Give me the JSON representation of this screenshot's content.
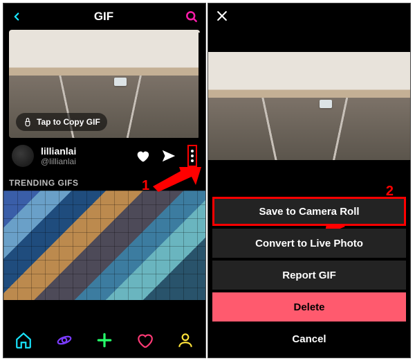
{
  "left": {
    "header_title": "GIF",
    "tap_label": "Tap to Copy GIF",
    "author_name": "lillianlai",
    "author_handle": "@lillianlai",
    "trending_label": "TRENDING GIFS",
    "annotation": "1"
  },
  "right": {
    "annotation": "2",
    "sheet": {
      "save": "Save to Camera Roll",
      "convert": "Convert to Live Photo",
      "report": "Report GIF",
      "delete": "Delete",
      "cancel": "Cancel"
    }
  },
  "colors": {
    "cyan": "#19e6ff",
    "magenta": "#ff1caa",
    "purple": "#7b3bff",
    "green": "#26ff6a",
    "pink": "#ff3a76",
    "yellow": "#ffe33a",
    "red_anno": "#ff0000"
  }
}
